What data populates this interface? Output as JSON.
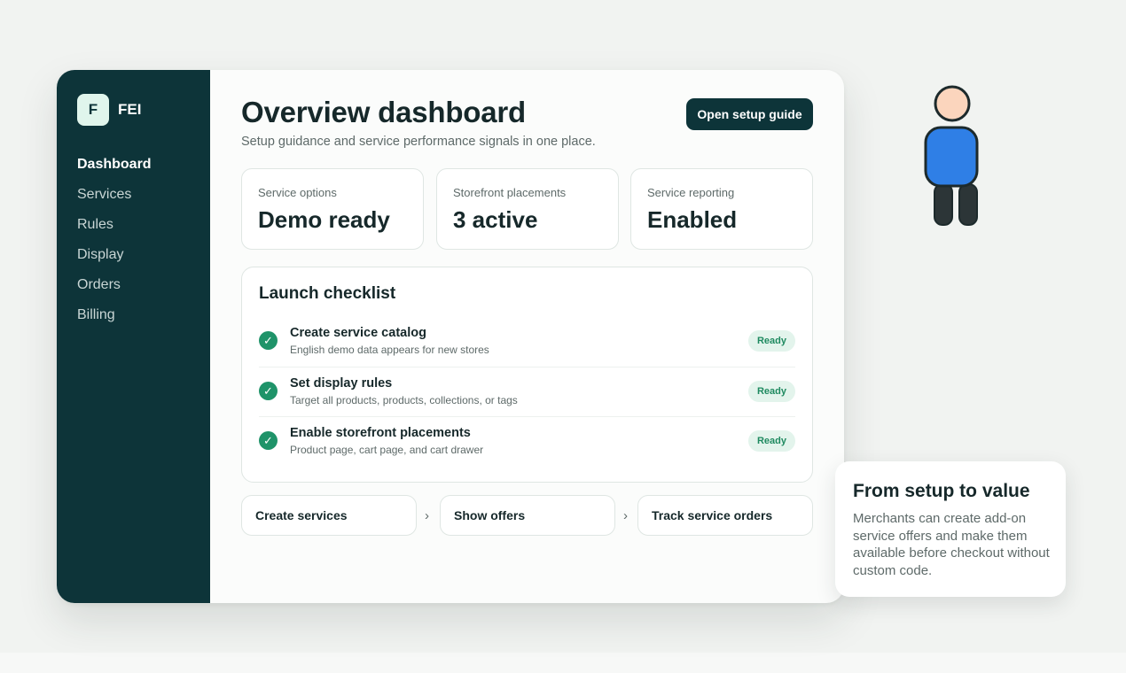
{
  "brand": {
    "logo_letter": "F",
    "name": "FEI"
  },
  "sidebar": {
    "items": [
      {
        "label": "Dashboard",
        "active": true
      },
      {
        "label": "Services",
        "active": false
      },
      {
        "label": "Rules",
        "active": false
      },
      {
        "label": "Display",
        "active": false
      },
      {
        "label": "Orders",
        "active": false
      },
      {
        "label": "Billing",
        "active": false
      }
    ]
  },
  "header": {
    "title": "Overview dashboard",
    "subtitle": "Setup guidance and service performance signals in one place.",
    "setup_button_label": "Open setup guide"
  },
  "stats": [
    {
      "label": "Service options",
      "value": "Demo ready"
    },
    {
      "label": "Storefront placements",
      "value": "3 active"
    },
    {
      "label": "Service reporting",
      "value": "Enabled"
    }
  ],
  "checklist": {
    "title": "Launch checklist",
    "items": [
      {
        "title": "Create service catalog",
        "description": "English demo data appears for new stores",
        "status": "Ready",
        "icon": "check-icon"
      },
      {
        "title": "Set display rules",
        "description": "Target all products, products, collections, or tags",
        "status": "Ready",
        "icon": "check-icon"
      },
      {
        "title": "Enable storefront placements",
        "description": "Product page, cart page, and cart drawer",
        "status": "Ready",
        "icon": "check-icon"
      }
    ]
  },
  "flow": {
    "steps": [
      "Create services",
      "Show offers",
      "Track service orders"
    ],
    "separator": "›"
  },
  "callout": {
    "title": "From setup to value",
    "body": "Merchants can create add-on service offers and make them available before checkout without custom code."
  },
  "colors": {
    "sidebar_bg": "#0d3439",
    "accent_green": "#1f9369",
    "badge_bg": "#e3f4ec",
    "person_head": "#fbd5bd",
    "person_body": "#2f7fe6",
    "person_legs": "#2c3537"
  }
}
